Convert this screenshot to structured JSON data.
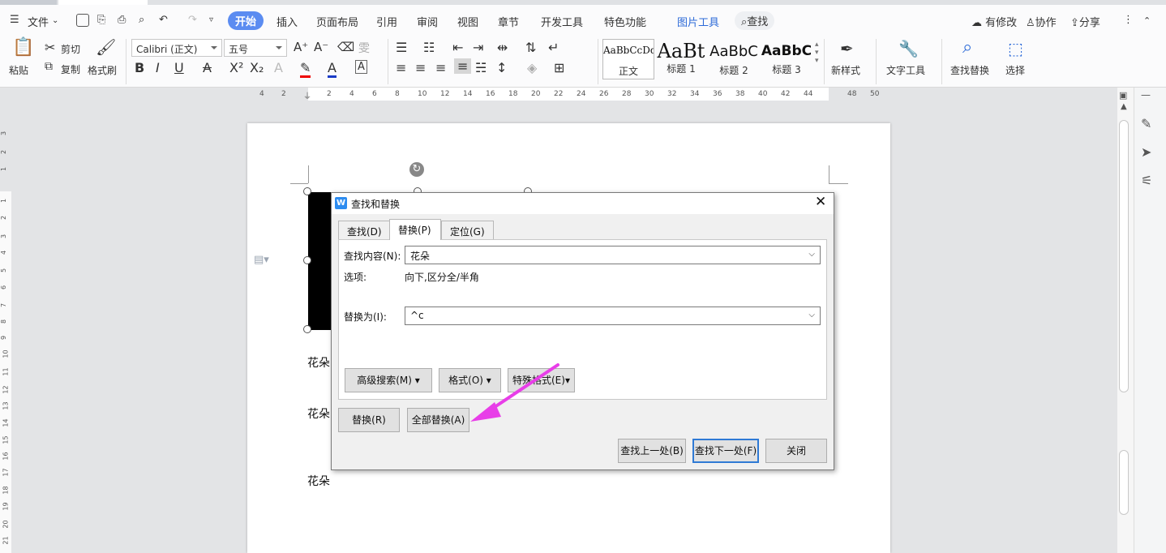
{
  "menubar": {
    "file_label": "文件",
    "tabs": [
      "开始",
      "插入",
      "页面布局",
      "引用",
      "审阅",
      "视图",
      "章节",
      "开发工具",
      "特色功能"
    ],
    "picture_tools": "图片工具",
    "search_label": "查找",
    "has_changes": "有修改",
    "collab": "协作",
    "share": "分享"
  },
  "ribbon": {
    "paste": "粘贴",
    "cut": "剪切",
    "copy": "复制",
    "format_painter": "格式刷",
    "font_name": "Calibri (正文)",
    "font_size": "五号",
    "styles": [
      {
        "preview": "AaBbCcDd",
        "label": "正文"
      },
      {
        "preview": "AaBt",
        "label": "标题 1"
      },
      {
        "preview": "AaBbC",
        "label": "标题 2"
      },
      {
        "preview": "AaBbC",
        "label": "标题 3"
      }
    ],
    "new_style": "新样式",
    "text_tools": "文字工具",
    "find_replace": "查找替换",
    "select": "选择"
  },
  "ruler": {
    "h_numbers": [
      "4",
      "2",
      "2",
      "4",
      "6",
      "8",
      "10",
      "12",
      "14",
      "16",
      "18",
      "20",
      "22",
      "24",
      "26",
      "28",
      "30",
      "32",
      "34",
      "36",
      "38",
      "40",
      "42",
      "44",
      "48",
      "50"
    ],
    "v_numbers": [
      "3",
      "2",
      "1",
      "1",
      "2",
      "3",
      "4",
      "5",
      "6",
      "7",
      "8",
      "9",
      "10",
      "11",
      "12",
      "13",
      "14",
      "15",
      "16",
      "17",
      "18",
      "19",
      "20",
      "21"
    ]
  },
  "document": {
    "lines": [
      "花朵",
      "花朵",
      "花朵"
    ]
  },
  "dialog": {
    "title": "查找和替换",
    "tabs": [
      "查找(D)",
      "替换(P)",
      "定位(G)"
    ],
    "find_label": "查找内容(N):",
    "find_value": "花朵",
    "options_label": "选项:",
    "options_value": "向下,区分全/半角",
    "replace_label": "替换为(I):",
    "replace_value": "^c",
    "advanced_search": "高级搜索(M)",
    "format": "格式(O)",
    "special_format": "特殊格式(E)",
    "replace_btn": "替换(R)",
    "replace_all_btn": "全部替换(A)",
    "find_prev": "查找上一处(B)",
    "find_next": "查找下一处(F)",
    "close": "关闭"
  },
  "colors": {
    "accent": "#5b8cf1",
    "arrow": "#e83ee8",
    "primary_border": "#2f7ad5"
  }
}
